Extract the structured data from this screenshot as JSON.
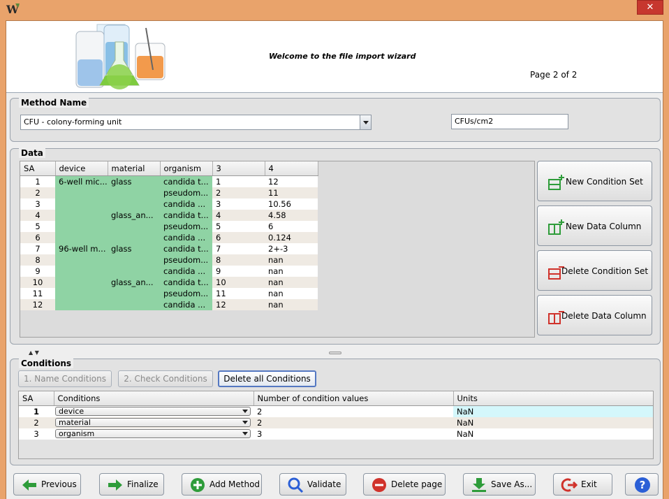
{
  "window": {
    "title_icon": "w-logo-icon",
    "close_label": "✕"
  },
  "header": {
    "welcome": "Welcome to the file import wizard",
    "page_indicator": "Page 2 of 2"
  },
  "method": {
    "title": "Method Name",
    "selected": "CFU - colony-forming unit",
    "unit": "CFUs/cm2"
  },
  "data_panel": {
    "title": "Data",
    "columns": [
      "SA",
      "device",
      "material",
      "organism",
      "3",
      "4"
    ],
    "rows": [
      [
        "1",
        "6-well mic...",
        "glass",
        "candida  t...",
        "1",
        "12"
      ],
      [
        "2",
        "",
        "",
        "pseudom...",
        "2",
        "11"
      ],
      [
        "3",
        "",
        "",
        "candida  ...",
        "3",
        "10.56"
      ],
      [
        "4",
        "",
        "glass_an...",
        "candida  t...",
        "4",
        "4.58"
      ],
      [
        "5",
        "",
        "",
        "pseudom...",
        "5",
        "6"
      ],
      [
        "6",
        "",
        "",
        "candida  ...",
        "6",
        "0.124"
      ],
      [
        "7",
        "96-well m...",
        "glass",
        "candida  t...",
        "7",
        "2+-3"
      ],
      [
        "8",
        "",
        "",
        "pseudom...",
        "8",
        "nan"
      ],
      [
        "9",
        "",
        "",
        "candida  ...",
        "9",
        "nan"
      ],
      [
        "10",
        "",
        "glass_an...",
        "candida  t...",
        "10",
        "nan"
      ],
      [
        "11",
        "",
        "",
        "pseudom...",
        "11",
        "nan"
      ],
      [
        "12",
        "",
        "",
        "candida  ...",
        "12",
        "nan"
      ]
    ],
    "buttons": {
      "new_condition_set": "New Condition Set",
      "new_data_column": "New Data Column",
      "delete_condition_set": "Delete Condition Set",
      "delete_data_column": "Delete Data Column"
    }
  },
  "conditions_panel": {
    "title": "Conditions",
    "tabs": {
      "name_conditions": "1. Name Conditions",
      "check_conditions": "2. Check Conditions",
      "delete_all": "Delete all Conditions"
    },
    "columns": [
      "SA",
      "Conditions",
      "Number of condition values",
      "Units"
    ],
    "rows": [
      {
        "sa": "1",
        "condition": "device",
        "count": "2",
        "units": "NaN"
      },
      {
        "sa": "2",
        "condition": "material",
        "count": "2",
        "units": "NaN"
      },
      {
        "sa": "3",
        "condition": "organism",
        "count": "3",
        "units": "NaN"
      }
    ]
  },
  "footer": {
    "previous": "Previous",
    "finalize": "Finalize",
    "add_method": "Add Method",
    "validate": "Validate",
    "delete_page": "Delete page",
    "save_as": "Save As...",
    "exit": "Exit",
    "help": "?"
  },
  "colors": {
    "accent_green": "#2e9c3a",
    "delete_red": "#d0322b",
    "grid_green": "#8fd3a4",
    "help_blue": "#2b5fd6"
  }
}
